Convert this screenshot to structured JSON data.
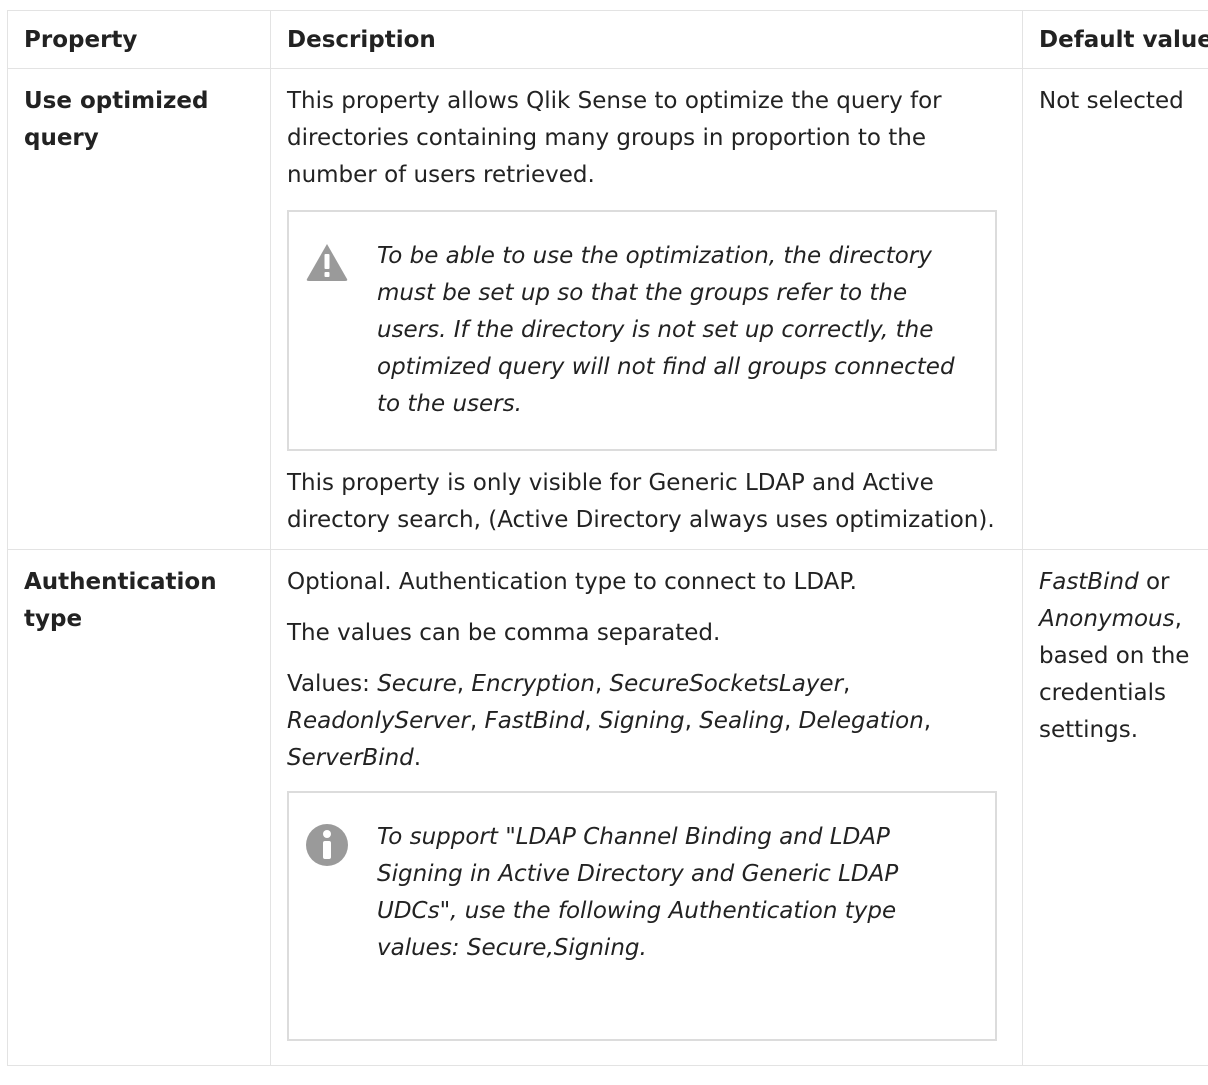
{
  "table": {
    "headers": {
      "property": "Property",
      "description": "Description",
      "default": "Default value"
    },
    "row1": {
      "property": "Use optimized query",
      "desc_intro": "This property allows Qlik Sense to optimize the query for directories containing many groups in proportion to the number of users retrieved.",
      "warning_icon": "warning-triangle-icon",
      "warning_text": "To be able to use the optimization, the directory must be set up so that the groups refer to the users. If the directory is not set up correctly, the optimized query will not find all groups connected to the users.",
      "desc_outro": "This property is only visible for Generic LDAP and Active directory search, (Active Directory always uses optimization).",
      "default": "Not selected"
    },
    "row2": {
      "property": "Authentication type",
      "desc_line1": "Optional. Authentication type to connect to LDAP.",
      "desc_line2": "The values can be comma separated.",
      "values_prefix": "Values: ",
      "values": [
        "Secure",
        "Encryption",
        "SecureSocketsLayer",
        "ReadonlyServer",
        "FastBind",
        "Signing",
        "Sealing",
        "Delegation",
        "ServerBind"
      ],
      "info_icon": "info-circle-icon",
      "info_text": "To support \"LDAP Channel Binding and LDAP Signing in Active Directory and Generic LDAP UDCs\", use the following Authentication type values: Secure,Signing.",
      "default_fastbind": "FastBind",
      "default_or": " or ",
      "default_anonymous": "Anonymous",
      "default_rest": ", based on the credentials settings."
    }
  },
  "colors": {
    "border": "#e3e3e3",
    "note_border": "#dcdcdc",
    "icon_gray": "#9a9a9a",
    "text": "#222222"
  }
}
